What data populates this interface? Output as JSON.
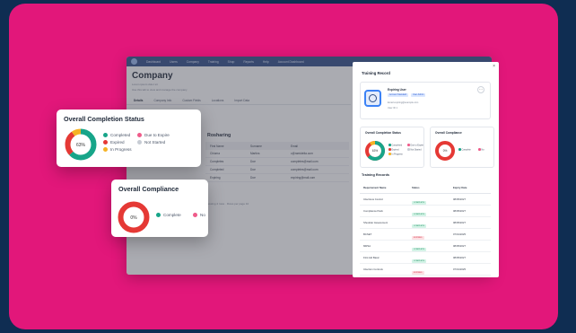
{
  "app": {
    "nav": [
      "Dashboard",
      "Users",
      "Company",
      "Training",
      "Shop",
      "Reports",
      "Help",
      "Account Dashboard"
    ],
    "title": "Company",
    "subtitle": "Lorem ipsum dolor sit",
    "subtitle2": "Use this tab to view and manage the company",
    "tabs": [
      "Details",
      "Company Info",
      "Custom Fields",
      "Locations",
      "Import Data"
    ],
    "section_title": "Rosharing",
    "table_headers": [
      "First Name",
      "Surname",
      "Email"
    ],
    "table_rows": [
      [
        "Chioma",
        "Martins",
        "c@ramidelta.com"
      ],
      [
        "Completes",
        "Doe",
        "completes@mail.com"
      ],
      [
        "Completed",
        "Doe",
        "completes@mail.com"
      ],
      [
        "Expiring",
        "Doe",
        "expiring@mail.com"
      ]
    ],
    "pager": "Showing 4 rows · Rows per page 10"
  },
  "sidebar_reporting_label": "Reporting",
  "panel": {
    "title": "Training Record",
    "close": "×",
    "user_name": "Expiring User",
    "badge_1": "Account Standard",
    "badge_2": "User Admin",
    "email": "Email expiring@example.com",
    "user_id": "User ID 1",
    "menu": "⋯",
    "completion_title": "Overall Completion Status",
    "completion_value": "63%",
    "completion_legend": [
      "Completed",
      "Expired",
      "In Progress",
      "Due to Expire",
      "Not Started"
    ],
    "compliance_title": "Overall Compliance",
    "compliance_value": "0%",
    "compliance_legend": [
      "Complete",
      "No"
    ],
    "records_title": "Training Records",
    "records_headers": [
      "Requirement Name",
      "Status",
      "Expiry Date"
    ],
    "records": [
      {
        "name": "Infectious Control",
        "status": "COMPLETE",
        "expiry": "08/05/2027"
      },
      {
        "name": "Compliance Pack",
        "status": "COMPLETE",
        "expiry": "08/05/2027"
      },
      {
        "name": "Shoulder Assessment",
        "status": "COMPLETE",
        "expiry": "08/05/2027"
      },
      {
        "name": "BCSET",
        "status": "EXPIRED",
        "expiry": "07/01/2025"
      },
      {
        "name": "MRSA",
        "status": "COMPLETE",
        "expiry": "08/05/2027"
      },
      {
        "name": "First Aid Basic",
        "status": "COMPLETE",
        "expiry": "08/05/2027"
      },
      {
        "name": "Infection Controls",
        "status": "EXPIRED",
        "expiry": "07/01/2025"
      }
    ]
  },
  "completion_card": {
    "title": "Overall Completion Status",
    "value": "63%",
    "legend": [
      {
        "label": "Completed",
        "color": "#17a589"
      },
      {
        "label": "Due to Expire",
        "color": "#ef5b8a"
      },
      {
        "label": "Expired",
        "color": "#e53935"
      },
      {
        "label": "Not Started",
        "color": "#c7ccd4"
      },
      {
        "label": "In Progress",
        "color": "#f5b325"
      }
    ],
    "segments": [
      {
        "label": "Completed",
        "percent": 63,
        "color": "#17a589"
      },
      {
        "label": "Expired",
        "percent": 27,
        "color": "#e53935"
      },
      {
        "label": "In Progress",
        "percent": 10,
        "color": "#f5b325"
      }
    ]
  },
  "compliance_card": {
    "title": "Overall Compliance",
    "value": "0%",
    "legend": [
      {
        "label": "Complete",
        "color": "#17a589"
      },
      {
        "label": "No",
        "color": "#ef5b8a"
      }
    ],
    "percent_complete": 0,
    "ring_color": "#e53935"
  },
  "colors": {
    "background": "#0f2d52",
    "card": "#e2177a",
    "nav": "#2f4d86"
  }
}
